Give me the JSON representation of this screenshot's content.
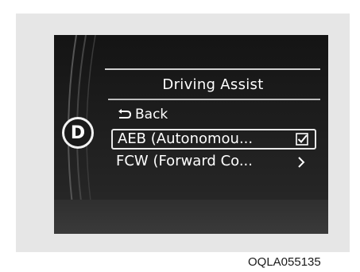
{
  "display": {
    "title": "Driving Assist",
    "gear_indicator": "D",
    "back_label": "Back",
    "back_icon": "return-arrow-icon",
    "menu_items": [
      {
        "label": "AEB (Autonomou...",
        "control": "checkbox",
        "checked": true,
        "selected": true
      },
      {
        "label": "FCW (Forward Co...",
        "control": "chevron-right",
        "selected": false
      }
    ]
  },
  "caption": "OQLA055135",
  "colors": {
    "screen_background": "#1e1e1e",
    "text": "#ffffff",
    "frame": "#e6e6e6"
  }
}
